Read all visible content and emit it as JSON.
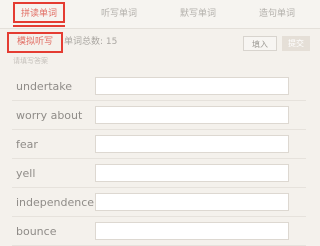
{
  "tabs": [
    {
      "label": "拼读单词",
      "active": true
    },
    {
      "label": "听写单词",
      "active": false
    },
    {
      "label": "默写单词",
      "active": false
    },
    {
      "label": "造句单词",
      "active": false
    }
  ],
  "toolbar": {
    "mode_label": "模拟听写",
    "count_label": "单词总数: 15",
    "fill_label": "填入",
    "submit_label": "提交"
  },
  "section_label": "请填写答案",
  "words": [
    {
      "word": "undertake",
      "answer": ""
    },
    {
      "word": "worry about",
      "answer": ""
    },
    {
      "word": "fear",
      "answer": ""
    },
    {
      "word": "yell",
      "answer": ""
    },
    {
      "word": "independence",
      "answer": ""
    },
    {
      "word": "bounce",
      "answer": ""
    }
  ],
  "colors": {
    "accent": "#e43c32",
    "background": "#f4f1ec"
  }
}
